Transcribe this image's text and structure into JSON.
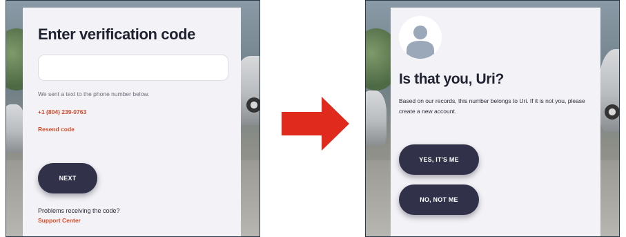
{
  "left_screen": {
    "title": "Enter verification code",
    "code_input": {
      "value": "",
      "placeholder": ""
    },
    "hint": "We sent a text to the phone number below.",
    "phone": "+1 (804) 239-0763",
    "resend": "Resend code",
    "next_label": "NEXT",
    "problems": "Problems receiving the code?",
    "support": "Support Center"
  },
  "right_screen": {
    "title": "Is that you, Uri?",
    "body": "Based on our records, this number belongs to Uri. If it is not you, please create a new account.",
    "yes_label": "YES, IT'S ME",
    "no_label": "NO, NOT ME"
  },
  "colors": {
    "accent": "#d64a2a",
    "button": "#31324a",
    "panel": "#f3f2f6",
    "arrow": "#e02a1e"
  },
  "icons": {
    "transition": "right-arrow-icon",
    "avatar": "user-avatar-icon"
  }
}
